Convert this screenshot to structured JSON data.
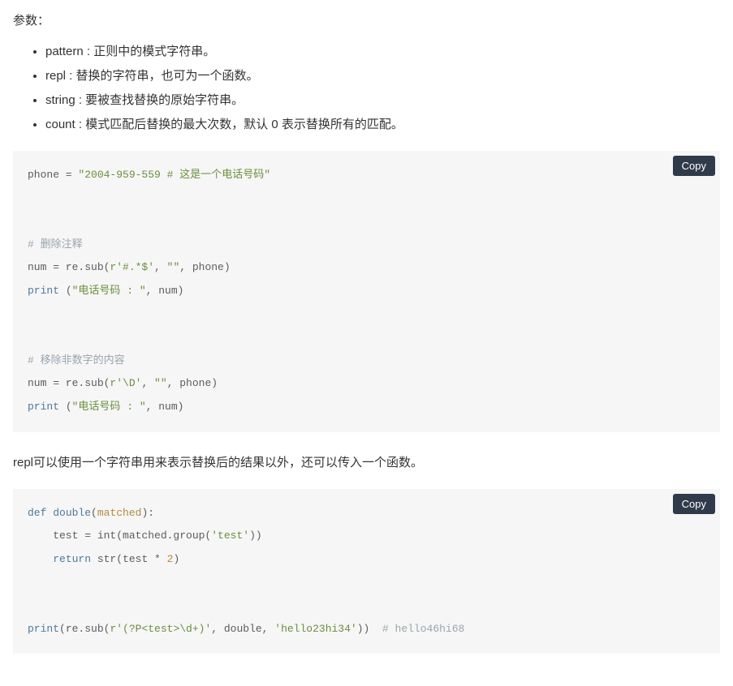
{
  "heading": "参数：",
  "params": [
    "pattern : 正则中的模式字符串。",
    "repl : 替换的字符串，也可为一个函数。",
    "string : 要被查找替换的原始字符串。",
    "count : 模式匹配后替换的最大次数，默认 0 表示替换所有的匹配。"
  ],
  "copy_label": "Copy",
  "paragraph": "repl可以使用一个字符串用来表示替换后的结果以外，还可以传入一个函数。",
  "code1": {
    "l1_a": "phone = ",
    "l1_b": "\"2004-959-559 # 这是一个电话号码\"",
    "l2": "# 删除注释",
    "l3_a": "num = re.sub(",
    "l3_b": "r'#.*$'",
    "l3_c": ", ",
    "l3_d": "\"\"",
    "l3_e": ", phone)",
    "l4_a": "print",
    "l4_b": " (",
    "l4_c": "\"电话号码 : \"",
    "l4_d": ", num)",
    "l5": "# 移除非数字的内容",
    "l6_a": "num = re.sub(",
    "l6_b": "r'\\D'",
    "l6_c": ", ",
    "l6_d": "\"\"",
    "l6_e": ", phone)",
    "l7_a": "print",
    "l7_b": " (",
    "l7_c": "\"电话号码 : \"",
    "l7_d": ", num)"
  },
  "code2": {
    "l1_a": "def",
    "l1_b": " ",
    "l1_c": "double",
    "l1_d": "(",
    "l1_e": "matched",
    "l1_f": "):",
    "l2_a": "    test = int(matched.group(",
    "l2_b": "'test'",
    "l2_c": "))",
    "l3_a": "    ",
    "l3_b": "return",
    "l3_c": " str(test * ",
    "l3_d": "2",
    "l3_e": ")",
    "l4_a": "print",
    "l4_b": "(re.sub(",
    "l4_c": "r'(?P<test>\\d+)'",
    "l4_d": ", double, ",
    "l4_e": "'hello23hi34'",
    "l4_f": "))  ",
    "l4_g": "# hello46hi68"
  }
}
